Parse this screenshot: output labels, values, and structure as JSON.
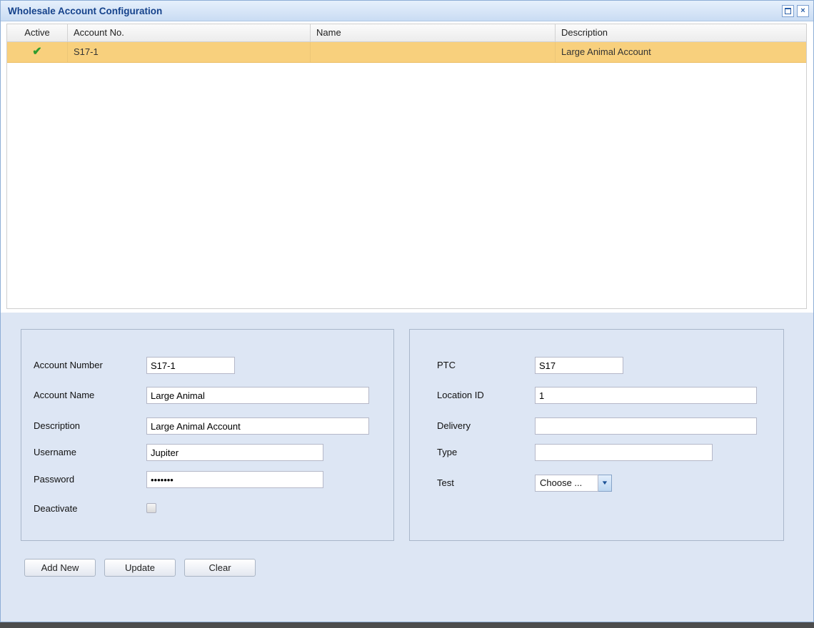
{
  "window": {
    "title": "Wholesale Account Configuration"
  },
  "icons": {
    "check": "✔",
    "close": "×",
    "dropdown": "▼"
  },
  "grid": {
    "columns": {
      "active": "Active",
      "account_no": "Account No.",
      "name": "Name",
      "description": "Description"
    },
    "row": {
      "active": true,
      "account_no": "S17-1",
      "name": "",
      "description": "Large Animal Account"
    }
  },
  "form_left": {
    "account_number": {
      "label": "Account Number",
      "value": "S17-1"
    },
    "account_name": {
      "label": "Account Name",
      "value": "Large Animal"
    },
    "description": {
      "label": "Description",
      "value": "Large Animal Account"
    },
    "username": {
      "label": "Username",
      "value": "Jupiter"
    },
    "password": {
      "label": "Password",
      "value": "•••••••"
    },
    "deactivate": {
      "label": "Deactivate",
      "checked": false
    }
  },
  "form_right": {
    "ptc": {
      "label": "PTC",
      "value": "S17"
    },
    "location_id": {
      "label": "Location ID",
      "value": "1"
    },
    "delivery": {
      "label": "Delivery",
      "value": ""
    },
    "type": {
      "label": "Type",
      "value": ""
    },
    "test": {
      "label": "Test",
      "value": "Choose ..."
    }
  },
  "buttons": {
    "add_new": "Add New",
    "update": "Update",
    "clear": "Clear"
  }
}
